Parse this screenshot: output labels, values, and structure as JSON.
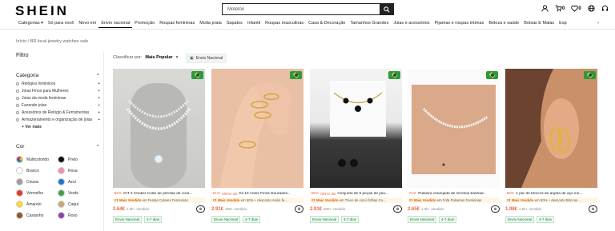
{
  "header": {
    "logo": "SHEIN",
    "search_value": "Moleton",
    "cart_count": "0",
    "wishlist_count": "0"
  },
  "nav": {
    "items": [
      "Categorias ▾",
      "Só para você",
      "Novo em",
      "Envio nacional",
      "Promoção",
      "Roupas femininas",
      "Moda praia",
      "Sapatos",
      "Infantil",
      "Roupas masculinas",
      "Casa & Decoração",
      "Tamanhos Grandes",
      "Joias e acessórios",
      "Pijamas e roupas íntimas",
      "Beleza e saúde",
      "Bolsas E Malas",
      "Esp"
    ]
  },
  "breadcrumb": "Início / BR local jewelry watches sale",
  "filter": {
    "title": "Filtro",
    "category_label": "Categoria",
    "categories": [
      "Relógios femininos",
      "Joias Finos para Mulheres",
      "Joias da moda femininas",
      "Fazendo joias",
      "Acessórios de Relógio & Ferramentas",
      "Armazenamento e organização de joias"
    ],
    "more": "+ Ver mais",
    "color_label": "Cor",
    "colors": [
      {
        "name": "Multicolorido",
        "hex": "#e77"
      },
      {
        "name": "Preto",
        "hex": "#111111"
      },
      {
        "name": "Branco",
        "hex": "#ffffff"
      },
      {
        "name": "Rosa",
        "hex": "#f48fb1"
      },
      {
        "name": "Cinzas",
        "hex": "#9e9e9e"
      },
      {
        "name": "Azul",
        "hex": "#1976d2"
      },
      {
        "name": "Vermelho",
        "hex": "#e53935"
      },
      {
        "name": "Verde",
        "hex": "#43a047"
      },
      {
        "name": "Amarelo",
        "hex": "#fdd835"
      },
      {
        "name": "Caqui",
        "hex": "#c8a96e"
      },
      {
        "name": "Castanho",
        "hex": "#8d5a2b"
      },
      {
        "name": "Roxo",
        "hex": "#8e44ad"
      }
    ]
  },
  "sort": {
    "label": "Classificar por:",
    "value": "Mais Popular",
    "chip": "Envio Nacional"
  },
  "products": [
    {
      "discount": "-56%",
      "prefix": "",
      "name": "KIT 2 Choker Colar de pérolas de cora...",
      "rank": "#1 Mais Vendido",
      "rank_in": "em Festas Colares Femininas",
      "price": "3.64€",
      "sold": "1.0k+ vendido",
      "ship": "Envio Nacional",
      "days": "4-7 dias"
    },
    {
      "discount": "-61%",
      "prefix": "Último dia",
      "name": "Kit 10 Anéis Finos Dourados...",
      "rank": "#1 Mais Vendido",
      "rank_in": "em 50% + desconto Anéis fe...",
      "price": "2.91€",
      "sold": "400+ vendido",
      "ship": "Envio Nacional",
      "days": "4-7 dias"
    },
    {
      "discount": "-56%",
      "prefix": "Último dia",
      "name": "Conjunto de 5 peças de joia...",
      "rank": "#1 Mais Vendido",
      "rank_in": "em Trevo de cinco folhas Co...",
      "price": "2.91€",
      "sold": "600+ vendido",
      "ship": "Envio Nacional",
      "days": "4-7 dias"
    },
    {
      "discount": "-71%",
      "prefix": "",
      "name": "Pulseira cravejada de zircônia banhad...",
      "rank": "#1 Mais Vendido",
      "rank_in": "em Fofa Pulseiras Femininas",
      "price": "2.65€",
      "sold": "1.2k+ vendido",
      "ship": "Envio Nacional",
      "days": "4-7 dias"
    },
    {
      "discount": "-66%",
      "prefix": "",
      "name": "1 par de brincos de argola de aço ino...",
      "rank": "#1 Mais Vendido",
      "rank_in": "em 50% + desconto Brincos...",
      "price": "1.98€",
      "sold": "1.5k+ vendido",
      "ship": "Envio Nacional",
      "days": "4-7 dias"
    }
  ]
}
